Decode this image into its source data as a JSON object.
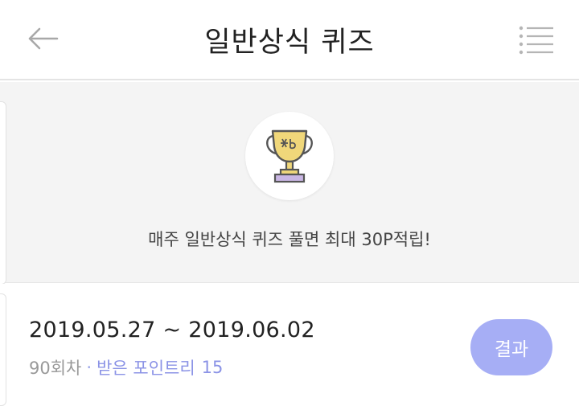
{
  "header": {
    "title": "일반상식 퀴즈",
    "back_icon": "arrow-left-icon",
    "menu_icon": "list-menu-icon"
  },
  "banner": {
    "icon": "trophy-icon",
    "text": "매주 일반상식 퀴즈 풀면 최대 30P적립!"
  },
  "quiz_items": [
    {
      "date_range": "2019.05.27 ~ 2019.06.02",
      "round": "90회차",
      "separator": "·",
      "points_label": "받은 포인트리",
      "points_value": "15",
      "result_label": "결과"
    }
  ],
  "colors": {
    "accent": "#a6aef5",
    "points_text": "#8b93e6",
    "trophy_gold": "#f0d77a",
    "trophy_base": "#c9b6e4"
  }
}
